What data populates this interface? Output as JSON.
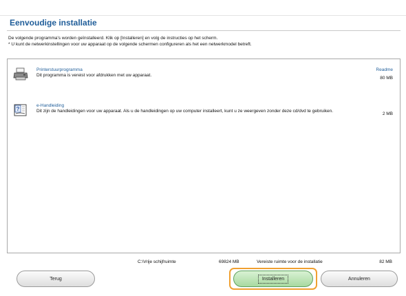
{
  "title": "Eenvoudige installatie",
  "description": [
    "De volgende programma's worden geïnstalleerd. Klik op [Installeren] en volg de instructies op het scherm.",
    "* U kunt de netwerkinstellingen voor uw apparaat op de volgende schermen configureren als het een netwerkmodel betreft."
  ],
  "programs": [
    {
      "name": "Printerstuurprogramma",
      "description": "Dit programma is vereist voor afdrukken met uw apparaat.",
      "size": "80 MB",
      "readme": "Readme",
      "icon": "printer-icon"
    },
    {
      "name": "e-Handleiding",
      "description": "Dit zijn de handleidingen voor uw apparaat. Als u de handleidingen op uw computer installeert, kunt u ze weergeven zonder deze cd/dvd te gebruiken.",
      "size": "2 MB",
      "icon": "manual-book-icon"
    }
  ],
  "disk": {
    "free_label": "C:\\Vrije schijfruimte",
    "free_value": "69824 MB",
    "required_label": "Vereiste ruimte voor de installatie",
    "required_value": "82 MB"
  },
  "buttons": {
    "back": "Terug",
    "install": "Installeren",
    "cancel": "Annuleren"
  },
  "colors": {
    "title": "#1f5d99",
    "link": "#1f5d99",
    "install_bg": "#a8d9a0",
    "focus_outline": "#f0a030"
  }
}
